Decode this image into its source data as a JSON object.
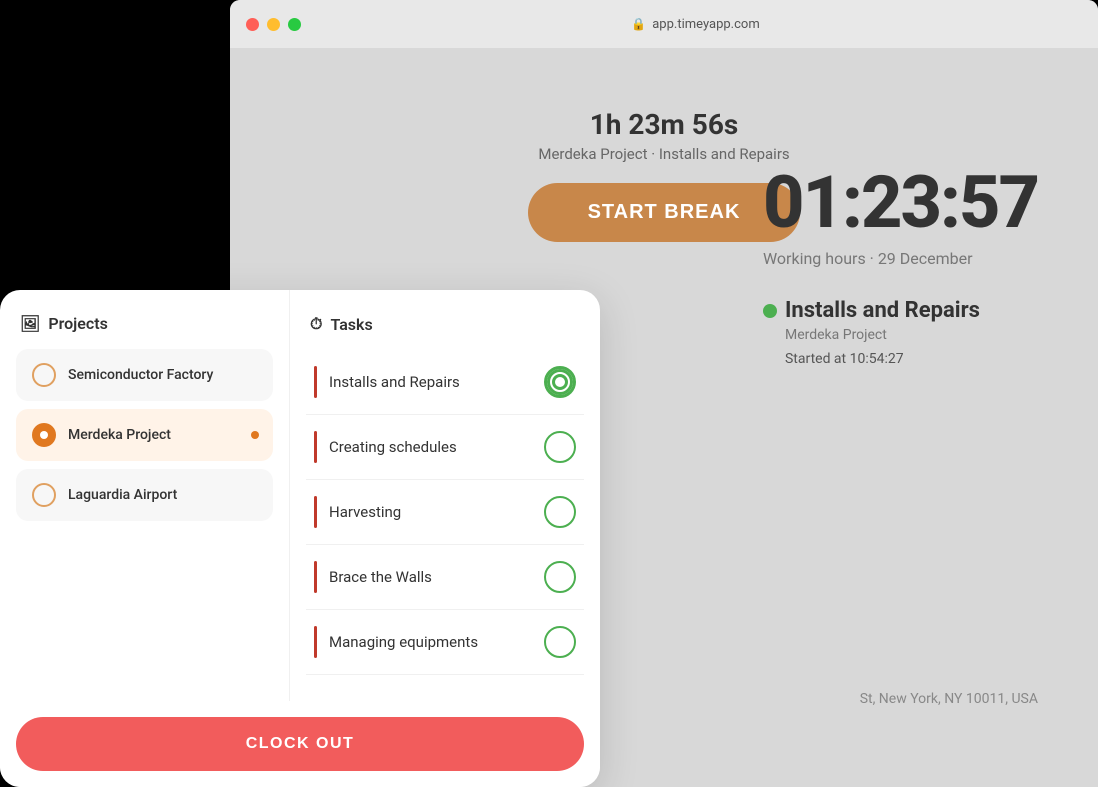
{
  "browser": {
    "address": "app.timeyapp.com",
    "traffic_lights": [
      "red",
      "yellow",
      "green"
    ]
  },
  "timer": {
    "duration": "1h 23m 56s",
    "subtitle": "Merdeka Project · Installs and Repairs",
    "start_break_label": "START BREAK"
  },
  "big_clock": {
    "time": "01:23:57",
    "subtitle": "Working hours · 29 December"
  },
  "active_task": {
    "name": "Installs and Repairs",
    "project": "Merdeka Project",
    "started": "Started at 10:54:27"
  },
  "bottom_address": "St, New York, NY 10011, USA",
  "projects_panel": {
    "header": "Projects",
    "header_icon": "🖼",
    "items": [
      {
        "name": "Semiconductor Factory",
        "active": false
      },
      {
        "name": "Merdeka Project",
        "active": true
      },
      {
        "name": "Laguardia Airport",
        "active": false
      }
    ]
  },
  "tasks_panel": {
    "header": "Tasks",
    "header_icon": "⏱",
    "items": [
      {
        "name": "Installs and Repairs",
        "selected": true
      },
      {
        "name": "Creating schedules",
        "selected": false
      },
      {
        "name": "Harvesting",
        "selected": false
      },
      {
        "name": "Brace the Walls",
        "selected": false
      },
      {
        "name": "Managing equipments",
        "selected": false
      }
    ]
  },
  "clock_out": {
    "label": "CLOCK OUT"
  }
}
